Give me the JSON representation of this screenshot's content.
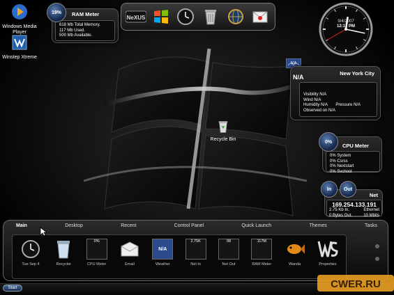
{
  "desktop": {
    "icons": [
      {
        "label": "Windows Media Player"
      },
      {
        "label": "Winstep Xtreme"
      }
    ],
    "recycle_bin_label": "Recycle Bin"
  },
  "ram_meter": {
    "title": "RAM Meter",
    "percent": "19%",
    "lines": [
      "618 Mb Total Memory.",
      "117 Mb Used.",
      "500 Mb Available."
    ]
  },
  "clock": {
    "date": "9/4/2007",
    "time": "12:17 PM",
    "hour": 12,
    "minute": 17
  },
  "weather": {
    "city": "New York City",
    "temp": "N/A",
    "icon_text": "N/A",
    "lines": [
      "Visibility N/A",
      "Wind N/A",
      "Humidity N/A",
      "Observed on N/A"
    ],
    "pressure": "Pressure N/A"
  },
  "cpu_meter": {
    "title": "CPU Meter",
    "percent": "0%",
    "lines": [
      "0% System",
      "0% Csrss",
      "0% Nextstart",
      "0% Svchost"
    ]
  },
  "net_meter": {
    "in_label": "In",
    "out_label": "Out",
    "title": "Net",
    "ip": "169.254.133.191",
    "row1_left": "2.75 Kb In.",
    "row1_right": "Ethernet",
    "row2_left": "0 Bytes Out.",
    "row2_right": "10 Mbits"
  },
  "dock": {
    "tabs": [
      {
        "label": "Main",
        "active": true
      },
      {
        "label": "Desktop"
      },
      {
        "label": "Recent"
      },
      {
        "label": "Control Panel"
      },
      {
        "label": "Quick Launch"
      },
      {
        "label": "Themes"
      },
      {
        "label": "Tasks"
      }
    ],
    "items": [
      {
        "label": "Tue Sep 4",
        "kind": "clock"
      },
      {
        "label": "Recycler",
        "kind": "recycle"
      },
      {
        "label": "CPU Meter",
        "kind": "meter",
        "value": "0%"
      },
      {
        "label": "Email",
        "kind": "email"
      },
      {
        "label": "Weather",
        "kind": "meter",
        "value": "N/A"
      },
      {
        "label": "Net In",
        "kind": "meter",
        "value": "2.75K"
      },
      {
        "label": "Net Out",
        "kind": "meter",
        "value": "08"
      },
      {
        "label": "RAM Meter",
        "kind": "meter",
        "value": "117M"
      },
      {
        "label": "Wanda",
        "kind": "fish"
      },
      {
        "label": "Properties",
        "kind": "ws"
      }
    ]
  },
  "taskbar": {
    "start_label": "Start"
  },
  "watermark": "CWER.RU"
}
